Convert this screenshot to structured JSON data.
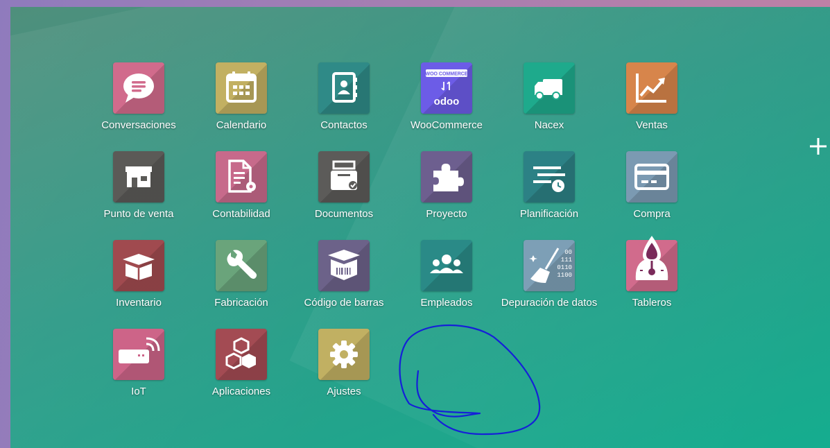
{
  "apps": [
    {
      "label": "Conversaciones",
      "icon": "chat-bubble-icon",
      "color": "#d16b8c"
    },
    {
      "label": "Calendario",
      "icon": "calendar-icon",
      "color": "#c2b062"
    },
    {
      "label": "Contactos",
      "icon": "address-book-icon",
      "color": "#2f8a87"
    },
    {
      "label": "WooCommerce",
      "icon": "woocommerce-odoo-logo",
      "color": "#6c5ce7",
      "logo_text_top": "WOO COMMERCE",
      "logo_text_bottom": "odoo"
    },
    {
      "label": "Nacex",
      "icon": "truck-icon",
      "color": "#1eaa8c"
    },
    {
      "label": "Ventas",
      "icon": "trend-chart-icon",
      "color": "#d7854b"
    },
    {
      "label": "Punto de venta",
      "icon": "shop-icon",
      "color": "#5b5a57"
    },
    {
      "label": "Contabilidad",
      "icon": "invoice-gear-icon",
      "color": "#c76a8b"
    },
    {
      "label": "Documentos",
      "icon": "document-tray-icon",
      "color": "#5c5b59"
    },
    {
      "label": "Proyecto",
      "icon": "puzzle-icon",
      "color": "#6d5f8f"
    },
    {
      "label": "Planificación",
      "icon": "schedule-clock-icon",
      "color": "#2c8185"
    },
    {
      "label": "Compra",
      "icon": "credit-card-icon",
      "color": "#7b9ab2"
    },
    {
      "label": "Inventario",
      "icon": "open-box-icon",
      "color": "#a04a4f"
    },
    {
      "label": "Fabricación",
      "icon": "wrench-icon",
      "color": "#6aa47b"
    },
    {
      "label": "Código de barras",
      "icon": "barcode-box-icon",
      "color": "#6c6289"
    },
    {
      "label": "Empleados",
      "icon": "people-group-icon",
      "color": "#2a8a87"
    },
    {
      "label": "Depuración de datos",
      "icon": "broom-binary-icon",
      "color": "#7d9fb6",
      "binary_lines": [
        "00",
        "111",
        "0110",
        "1100"
      ]
    },
    {
      "label": "Tableros",
      "icon": "gauge-drop-icon",
      "color": "#d16b8c"
    },
    {
      "label": "IoT",
      "icon": "iot-device-icon",
      "color": "#cd6488"
    },
    {
      "label": "Aplicaciones",
      "icon": "cubes-icon",
      "color": "#a34b53"
    },
    {
      "label": "Ajustes",
      "icon": "gear-icon",
      "color": "#c1b062"
    }
  ],
  "colors": {
    "scribble": "#1520d8",
    "label_text": "#ffffff"
  }
}
